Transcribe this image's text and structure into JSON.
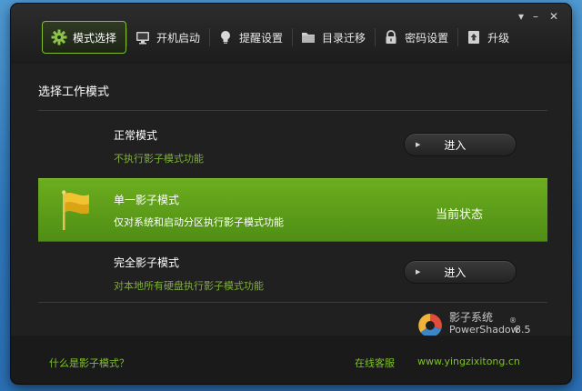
{
  "tabs": [
    {
      "label": "模式选择",
      "icon": "gear-icon"
    },
    {
      "label": "开机启动",
      "icon": "monitor-icon"
    },
    {
      "label": "提醒设置",
      "icon": "lightbulb-icon"
    },
    {
      "label": "目录迁移",
      "icon": "folder-icon"
    },
    {
      "label": "密码设置",
      "icon": "lock-icon"
    },
    {
      "label": "升级",
      "icon": "upgrade-icon"
    }
  ],
  "section_title": "选择工作模式",
  "modes": {
    "normal": {
      "title": "正常模式",
      "desc": "不执行影子模式功能",
      "button": "进入"
    },
    "single": {
      "title": "单一影子模式",
      "desc": "仅对系统和启动分区执行影子模式功能",
      "status": "当前状态"
    },
    "full": {
      "title": "完全影子模式",
      "desc": "对本地所有硬盘执行影子模式功能",
      "button": "进入"
    }
  },
  "logo": {
    "name_zh": "影子系统",
    "name_en": "PowerShadow",
    "version": "8.5",
    "reg": "®"
  },
  "footer": {
    "help_link": "什么是影子模式？",
    "support_link": "在线客服",
    "website": "www.yingzixitong.cn"
  },
  "window_controls": {
    "menu": "▾",
    "minimize": "–",
    "close": "✕"
  },
  "colors": {
    "accent": "#7fc02c",
    "active_row": "#5e9f1a"
  }
}
